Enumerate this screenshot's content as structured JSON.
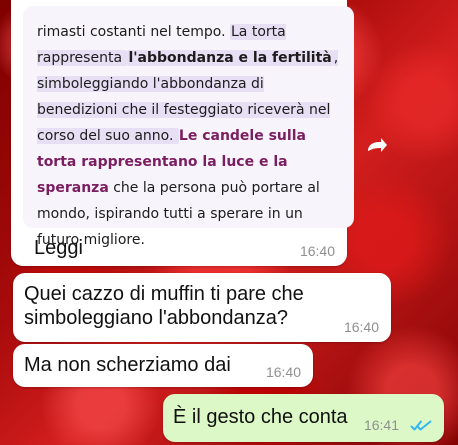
{
  "messages": [
    {
      "type": "quoted",
      "quote": {
        "segments": [
          {
            "text": "rimasti costanti nel tempo. ",
            "highlight": false,
            "bold": false,
            "purple": false
          },
          {
            "text": "La torta rappresenta ",
            "highlight": true,
            "bold": false,
            "purple": false
          },
          {
            "text": "l'abbondanza e la fertilità",
            "highlight": true,
            "bold": true,
            "purple": false
          },
          {
            "text": ", simboleggiando l'abbondanza di benedizioni che il festeggiato riceverà nel corso del suo anno. ",
            "highlight": true,
            "bold": false,
            "purple": false
          },
          {
            "text": "Le candele sulla torta rappresentano la luce e la speranza",
            "highlight": false,
            "bold": true,
            "purple": true
          },
          {
            "text": " che la persona può portare al mondo, ispirando tutti a sperare in un futuro migliore.",
            "highlight": false,
            "bold": false,
            "purple": false
          }
        ]
      },
      "text": "Leggi",
      "time": "16:40"
    },
    {
      "type": "incoming",
      "text": "Quei cazzo di muffin ti pare che simboleggiano l'abbondanza?",
      "time": "16:40"
    },
    {
      "type": "incoming",
      "text": "Ma non scherziamo dai",
      "time": "16:40"
    },
    {
      "type": "outgoing",
      "text": "È il gesto che conta",
      "time": "16:41",
      "status": "read"
    }
  ],
  "icons": {
    "forward": "forward-icon",
    "read_ticks": "double-check-icon"
  },
  "colors": {
    "read_ticks": "#34b7f1"
  }
}
